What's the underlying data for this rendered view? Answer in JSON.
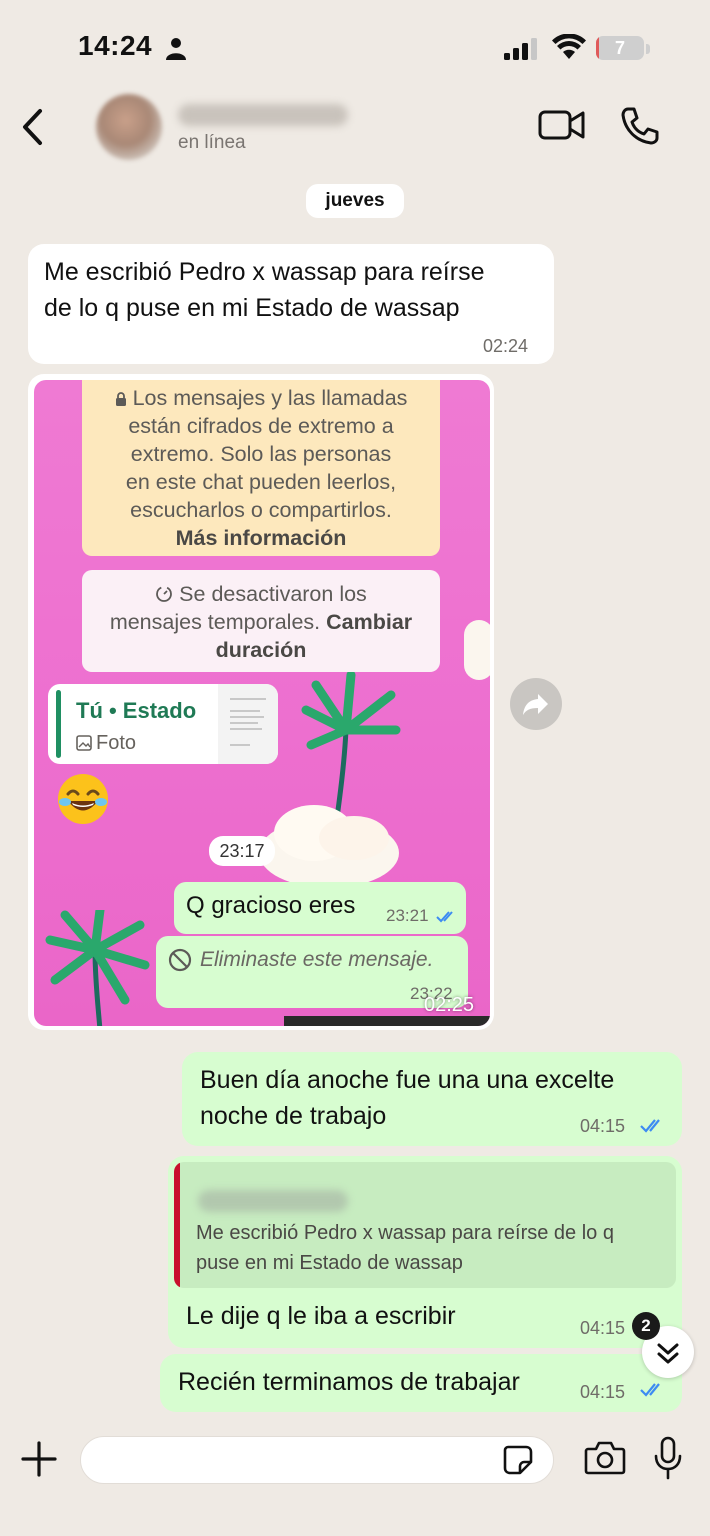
{
  "status_bar": {
    "time": "14:24",
    "battery": "7",
    "battery_level": 0.07
  },
  "header": {
    "back_icon": "chevron-left-icon",
    "contact_status": "en línea",
    "video_icon": "video-camera-icon",
    "phone_icon": "phone-icon"
  },
  "date_separator": "jueves",
  "messages": [
    {
      "direction": "in",
      "lines": [
        "Me escribió Pedro x wassap para reírse",
        "de lo q puse en mi Estado de wassap"
      ],
      "time": "02:24"
    },
    {
      "direction": "in",
      "type": "image",
      "time": "02:25",
      "screenshot": {
        "encryption_lines": [
          "Los mensajes y las llamadas",
          "están cifrados de extremo a",
          "extremo. Solo las personas",
          "en este chat pueden leerlos,",
          "escucharlos o compartirlos."
        ],
        "encryption_link": "Más información",
        "temp_line1": "Se desactivaron los",
        "temp_line2": "mensajes temporales.",
        "temp_link1": "Cambiar",
        "temp_link2": "duración",
        "quote_title": "Tú • Estado",
        "quote_sub": "Foto",
        "emoji": "😂",
        "pill_time": "23:17",
        "out_text": "Q gracioso eres",
        "out_time": "23:21",
        "deleted_text": "Eliminaste este mensaje.",
        "deleted_time": "23:22"
      }
    },
    {
      "direction": "out",
      "lines": [
        "Buen día anoche fue una una excelte",
        "noche de trabajo"
      ],
      "time": "04:15"
    },
    {
      "direction": "out",
      "quote": {
        "lines": [
          "Me escribió Pedro x wassap para reírse de lo q",
          "puse en mi Estado de wassap"
        ]
      },
      "lines": [
        "Le dije q le iba a escribir"
      ],
      "time": "04:15"
    },
    {
      "direction": "out",
      "lines": [
        "Recién terminamos de trabajar"
      ],
      "time": "04:15"
    }
  ],
  "scroll_down": {
    "badge": "2"
  },
  "composer": {
    "placeholder": ""
  },
  "colors": {
    "out_bubble": "#d7fdd0",
    "in_bubble": "#ffffff",
    "background": "#efeae4",
    "tick_blue": "#3d8bf2",
    "quote_bar": "#1f8f62",
    "reply_bar": "#c8102e"
  }
}
